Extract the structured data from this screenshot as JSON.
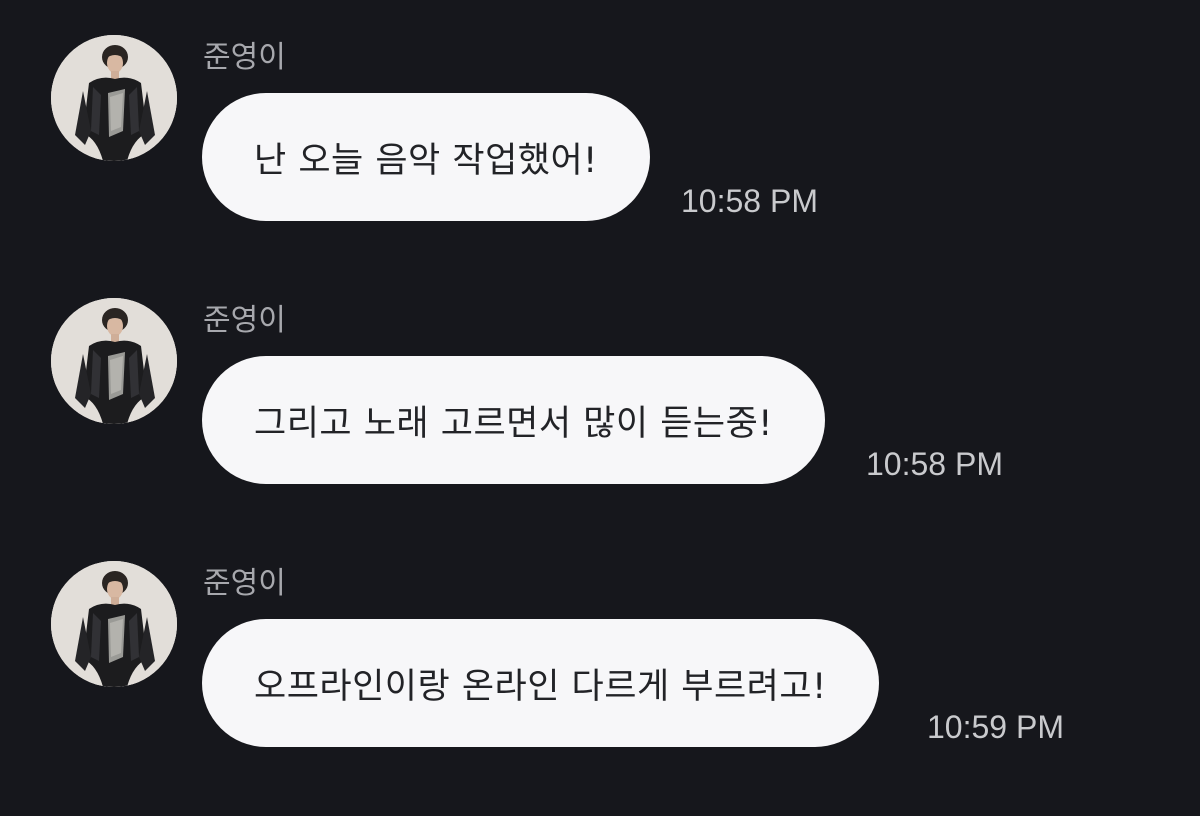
{
  "messages": [
    {
      "sender": "준영이",
      "text": "난 오늘 음악 작업했어!",
      "time": "10:58 PM"
    },
    {
      "sender": "준영이",
      "text": "그리고 노래 고르면서 많이 듣는중!",
      "time": "10:58 PM"
    },
    {
      "sender": "준영이",
      "text": "오프라인이랑 온라인 다르게 부르려고!",
      "time": "10:59 PM"
    }
  ],
  "colors": {
    "background": "#16171c",
    "bubble": "#f7f7f9",
    "bubble_text": "#222327",
    "sender_name": "#a7a8ad",
    "timestamp": "#c9cacd"
  },
  "icons": {
    "avatar": "profile-photo-icon"
  }
}
